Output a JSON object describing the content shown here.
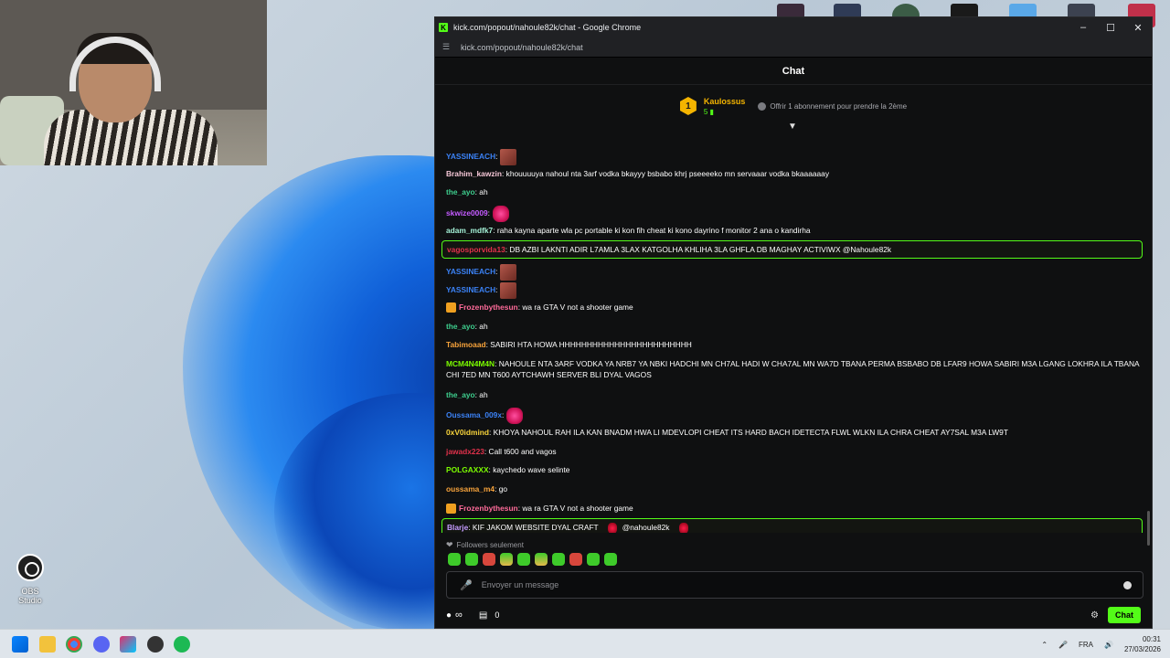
{
  "window": {
    "title": "kick.com/popout/nahoule82k/chat - Google Chrome",
    "url": "kick.com/popout/nahoule82k/chat",
    "favicon_letter": "K",
    "controls": {
      "minimize": "–",
      "maximize": "☐",
      "close": "✕"
    }
  },
  "chat": {
    "header": "Chat",
    "pinned": {
      "rank": "1",
      "name": "Kaulossus",
      "count": "5",
      "offer": "Offrir 1 abonnement pour prendre la 2ème"
    },
    "messages": [
      {
        "user": "YASSINEACH",
        "sep": ":",
        "text": "",
        "color": "#3b82f6",
        "emote": "face"
      },
      {
        "user": "Brahim_kawzin",
        "sep": ":",
        "text": " khouuuuya nahoul nta 3arf vodka bkayyy bsbabo khrj pseeeeko mn servaaar vodka bkaaaaaay",
        "color": "#f5c6d6"
      },
      {
        "user": "the_ayo",
        "sep": ":",
        "text": " ah",
        "color": "#3ecf8e"
      },
      {
        "user": "skwize0009",
        "sep": ":",
        "text": "",
        "color": "#c45bff",
        "emote": "pink"
      },
      {
        "user": "adam_mdfk7",
        "sep": ":",
        "text": " raha kayna aparte wla pc portable ki kon fih cheat ki kono dayrino f monitor 2 ana o kandirha",
        "color": "#a4f0d6"
      },
      {
        "user": "vagosporvida13",
        "sep": ":",
        "text": " DB AZBI LAKNTI ADIR L7AMLA 3LAX KATGOLHA KHLIHA 3LA GHFLA DB MAGHAY ACTIVIWX @Nahoule82k",
        "color": "#e0314b",
        "highlight": true
      },
      {
        "user": "YASSINEACH",
        "sep": ":",
        "text": "",
        "color": "#3b82f6",
        "emote": "face"
      },
      {
        "user": "YASSINEACH",
        "sep": ":",
        "text": "",
        "color": "#3b82f6",
        "emote": "face"
      },
      {
        "user": "Frozenbythesun",
        "sep": ":",
        "text": " wa ra GTA V not a shooter game",
        "color": "#ff6b9a",
        "badge": true
      },
      {
        "user": "the_ayo",
        "sep": ":",
        "text": " ah",
        "color": "#3ecf8e"
      },
      {
        "user": "Tabimoaad",
        "sep": ":",
        "text": " SABIRI HTA HOWA HHHHHHHHHHHHHHHHHHHHHHHH",
        "color": "#f7a33b"
      },
      {
        "user": "MCM4N4M4N",
        "sep": ":",
        "text": " NAHOULE NTA 3ARF VODKA YA NRB7 YA NBKI HADCHI MN CH7AL HADI W CHA7AL MN WA7D TBANA PERMA BSBABO DB LFAR9 HOWA SABIRI M3A LGANG LOKHRA ILA TBANA CHI 7ED MN T600 AYTCHAWH SERVER BLI DYAL VAGOS",
        "color": "#7cfc00"
      },
      {
        "user": "the_ayo",
        "sep": ":",
        "text": " ah",
        "color": "#3ecf8e"
      },
      {
        "user": "Oussama_009x",
        "sep": ":",
        "text": "",
        "color": "#3b82f6",
        "emote": "pink"
      },
      {
        "user": "0xV0idmind",
        "sep": ":",
        "text": " KHOYA NAHOUL RAH ILA KAN BNADM HWA LI MDEVLOPI CHEAT ITS HARD BACH IDETECTA FLWL WLKN ILA CHRA CHEAT AY7SAL M3A LW9T",
        "color": "#f7d33b"
      },
      {
        "user": "jawadx223",
        "sep": ":",
        "text": " Call t600 and vagos",
        "color": "#e0314b"
      },
      {
        "user": "POLGAXXX",
        "sep": ":",
        "text": " kaychedo wave selinte",
        "color": "#7cfc00"
      },
      {
        "user": "oussama_m4",
        "sep": ":",
        "text": " go",
        "color": "#f7a33b"
      },
      {
        "user": "Frozenbythesun",
        "sep": ":",
        "text": " wa ra GTA V not a shooter game",
        "color": "#ff6b9a",
        "badge": true
      },
      {
        "user": "Blarje",
        "sep": ":",
        "text": " KIF JAKOM WEBSITE DYAL CRAFT",
        "color": "#c49bff",
        "highlight": true,
        "trail": "@nahoule82k"
      }
    ],
    "followers_only": "Followers seulement",
    "input_placeholder": "Envoyer un message",
    "points_symbol": "∞",
    "store_count": "0",
    "send_label": "Chat"
  },
  "desktop": {
    "icon_label": "OBS Studio"
  },
  "taskbar": {
    "language": "FRA",
    "time": "00:31",
    "date": "27/03/2026"
  },
  "colors": {
    "accent": "#53fc18",
    "chat_bg": "#0f1011",
    "highlight_border": "#53fc18"
  }
}
